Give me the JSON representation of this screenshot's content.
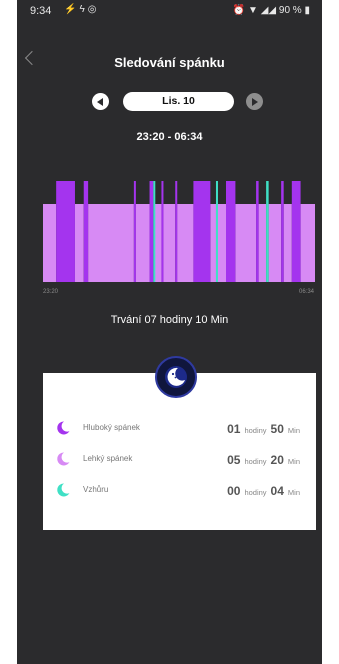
{
  "status_bar": {
    "time": "9:34",
    "battery": "90 %"
  },
  "header": {
    "title": "Sledování spánku"
  },
  "date_nav": {
    "date": "Lis. 10"
  },
  "time_range": "23:20  -  06:34",
  "axis": {
    "start": "23:20",
    "end": "06:34"
  },
  "duration_text": "Trvání 07 hodiny 10 Min",
  "colors": {
    "background": "#2b2b2d",
    "deep_sleep": "#a434ee",
    "light_sleep": "#d78af4",
    "awake": "#3fe0c5",
    "card": "#ffffff"
  },
  "chart_data": {
    "type": "bar",
    "start": "23:20",
    "end": "06:34",
    "series": [
      {
        "name": "Hluboký spánek",
        "color": "#a434ee"
      },
      {
        "name": "Lehký spánek",
        "color": "#d78af4"
      },
      {
        "name": "Vzhůru",
        "color": "#3fe0c5"
      }
    ],
    "segments": [
      {
        "from": "23:20",
        "to": "23:41",
        "stage": "Lehký spánek"
      },
      {
        "from": "23:41",
        "to": "00:11",
        "stage": "Hluboký spánek"
      },
      {
        "from": "00:11",
        "to": "00:25",
        "stage": "Lehký spánek"
      },
      {
        "from": "00:25",
        "to": "00:32",
        "stage": "Hluboký spánek"
      },
      {
        "from": "00:32",
        "to": "01:45",
        "stage": "Lehký spánek"
      },
      {
        "from": "01:45",
        "to": "01:48",
        "stage": "Hluboký spánek"
      },
      {
        "from": "01:48",
        "to": "02:10",
        "stage": "Lehký spánek"
      },
      {
        "from": "02:10",
        "to": "02:16",
        "stage": "Hluboký spánek"
      },
      {
        "from": "02:16",
        "to": "02:17",
        "stage": "Vzhůru"
      },
      {
        "from": "02:17",
        "to": "02:29",
        "stage": "Lehký spánek"
      },
      {
        "from": "02:29",
        "to": "02:32",
        "stage": "Hluboký spánek"
      },
      {
        "from": "02:32",
        "to": "02:51",
        "stage": "Lehký spánek"
      },
      {
        "from": "02:51",
        "to": "02:54",
        "stage": "Hluboký spánek"
      },
      {
        "from": "02:54",
        "to": "03:20",
        "stage": "Lehký spánek"
      },
      {
        "from": "03:20",
        "to": "03:47",
        "stage": "Hluboký spánek"
      },
      {
        "from": "03:47",
        "to": "03:56",
        "stage": "Lehký spánek"
      },
      {
        "from": "03:56",
        "to": "03:58",
        "stage": "Vzhůru"
      },
      {
        "from": "03:58",
        "to": "04:12",
        "stage": "Lehký spánek"
      },
      {
        "from": "04:12",
        "to": "04:27",
        "stage": "Hluboký spánek"
      },
      {
        "from": "04:27",
        "to": "05:00",
        "stage": "Lehký spánek"
      },
      {
        "from": "05:00",
        "to": "05:04",
        "stage": "Hluboký spánek"
      },
      {
        "from": "05:04",
        "to": "05:16",
        "stage": "Lehký spánek"
      },
      {
        "from": "05:16",
        "to": "05:20",
        "stage": "Vzhůru"
      },
      {
        "from": "05:20",
        "to": "05:40",
        "stage": "Lehký spánek"
      },
      {
        "from": "05:40",
        "to": "05:44",
        "stage": "Hluboký spánek"
      },
      {
        "from": "05:44",
        "to": "05:57",
        "stage": "Lehký spánek"
      },
      {
        "from": "05:57",
        "to": "06:11",
        "stage": "Hluboký spánek"
      },
      {
        "from": "06:11",
        "to": "06:34",
        "stage": "Lehký spánek"
      }
    ]
  },
  "summary": {
    "rows": [
      {
        "label": "Hluboký spánek",
        "hours": "01",
        "hours_unit": "hodiny",
        "minutes": "50",
        "minutes_unit": "Min",
        "color": "#a434ee"
      },
      {
        "label": "Lehký spánek",
        "hours": "05",
        "hours_unit": "hodiny",
        "minutes": "20",
        "minutes_unit": "Min",
        "color": "#d78af4"
      },
      {
        "label": "Vzhůru",
        "hours": "00",
        "hours_unit": "hodiny",
        "minutes": "04",
        "minutes_unit": "Min",
        "color": "#3fe0c5"
      }
    ]
  }
}
